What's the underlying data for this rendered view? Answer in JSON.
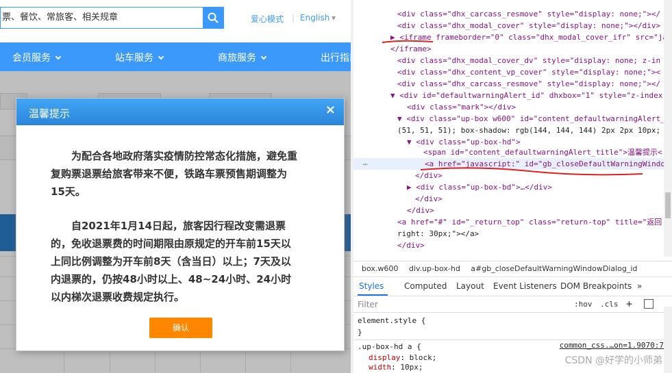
{
  "page": {
    "search_placeholder": "票、餐饮、常旅客、相关规章",
    "care_mode": "爱心模式",
    "language": "English",
    "nav": [
      "会员服务",
      "站车服务",
      "商旅服务",
      "出行指南"
    ]
  },
  "dialog": {
    "title": "温馨提示",
    "close": "×",
    "paragraph1": "为配合各地政府落实疫情防控常态化措施，避免重复购票退票给旅客带来不便，铁路车票预售期调整为15天。",
    "paragraph2": "自2021年1月14日起，旅客因行程改变需退票的，免收退票费的时间期限由原规定的开车前15天以上同比例调整为开车前8天（含当日）以上；7天及以内退票的，仍按48小时以上、48~24小时、24小时以内梯次退票收费规定执行。",
    "ok_label": "确认"
  },
  "devtools": {
    "lines": [
      "<div class=\"dhx_carcass_resmove\" style=\"display: none;\"></",
      "<div class=\"dhx_modal_cover\" style=\"display: none;\"></div>",
      "▶ <iframe frameborder=\"0\" class=\"dhx_modal_cover_ifr\" src=\"ja",
      "</iframe>",
      "<div class=\"dhx_modal_cover_dv\" style=\"display: none; z-in",
      "<div class=\"dhx_content_vp_cover\" style=\"display: none;\"><",
      "<div class=\"dhx_carcass_resmove\" style=\"display: none;\"></",
      "▼ <div id=\"defaultwarningAlert_id\" dhxbox=\"1\" style=\"z-index",
      "<div class=\"mark\"></div>",
      "▼ <div class=\"up-box w600\" id=\"content_defaultwarningAlert_",
      "(51, 51, 51); box-shadow: rgb(144, 144, 144) 2px 2px 10px;",
      "▼ <div class=\"up-box-hd\">",
      "<span id=\"content_defaultwarningAlert_title\">温馨提示<",
      "<a href=\"javascript:\" id=\"gb_closeDefaultWarningWindo",
      "</div>",
      "▶ <div class=\"up-box-bd\">…</div>",
      "</div>",
      "</div>",
      "<a href=\"#\" id=\"_return_top\" class=\"return-top\" title=\"返回",
      "right: 30px;\"></a>",
      "</div>"
    ],
    "breadcrumb": [
      "box.w600",
      "div.up-box-hd",
      "a#gb_closeDefaultWarningWindowDialog_id"
    ],
    "tabs": [
      "Styles",
      "Computed",
      "Layout",
      "Event Listeners",
      "DOM Breakpoints",
      "»"
    ],
    "filter_placeholder": "Filter",
    "filter_actions": [
      ":hov",
      ".cls",
      "+"
    ],
    "styles": {
      "element_style": "element.style {",
      "close_brace": "}",
      "rule_selector": ".up-box-hd a {",
      "rule_source": "common_css.…on=1.9070:7",
      "prop1": "display",
      "val1": "block;",
      "prop2": "width",
      "val2": "10px;"
    },
    "ellipsis": "…",
    "watermark": "CSDN @好学的小师弟"
  },
  "colors": {
    "brand_blue": "#3b99fc",
    "dialog_ok": "#ff8700",
    "annotation_red": "#e02020"
  }
}
